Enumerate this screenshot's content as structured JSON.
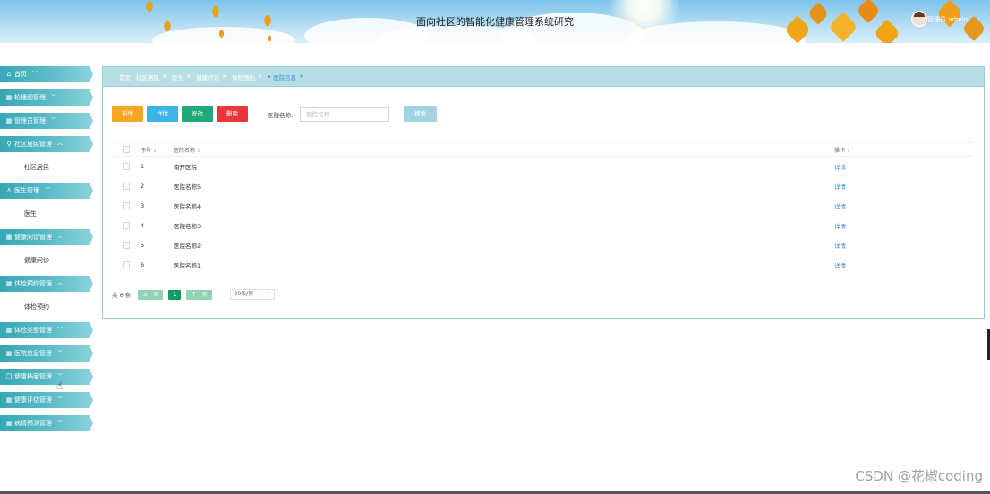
{
  "header": {
    "title": "面向社区的智能化健康管理系统研究",
    "user": "管理员 admin"
  },
  "sidebar": {
    "items": [
      {
        "label": "首页",
        "icon": "home-icon",
        "expanded": false
      },
      {
        "label": "轮播图管理",
        "icon": "grid-icon",
        "expanded": false
      },
      {
        "label": "管理员管理",
        "icon": "grid-icon",
        "expanded": false
      },
      {
        "label": "社区居民管理",
        "icon": "user-lock-icon",
        "expanded": true,
        "children": [
          "社区居民"
        ]
      },
      {
        "label": "医生管理",
        "icon": "user-icon",
        "expanded": true,
        "children": [
          "医生"
        ]
      },
      {
        "label": "健康问诊管理",
        "icon": "grid-icon",
        "expanded": true,
        "children": [
          "健康问诊"
        ]
      },
      {
        "label": "体检预约管理",
        "icon": "grid-icon",
        "expanded": true,
        "children": [
          "体检预约"
        ]
      },
      {
        "label": "体检类型管理",
        "icon": "grid-icon",
        "expanded": false
      },
      {
        "label": "医院信息管理",
        "icon": "grid-icon",
        "expanded": false
      },
      {
        "label": "健康档案管理",
        "icon": "copy-icon",
        "expanded": false
      },
      {
        "label": "健康评估管理",
        "icon": "grid-icon",
        "expanded": false
      },
      {
        "label": "病情预测管理",
        "icon": "grid-icon",
        "expanded": false
      }
    ]
  },
  "tabs": [
    {
      "label": "首页",
      "active": false
    },
    {
      "label": "社区居民",
      "active": false
    },
    {
      "label": "医生",
      "active": false
    },
    {
      "label": "健康问诊",
      "active": false
    },
    {
      "label": "体检预约",
      "active": false
    },
    {
      "label": "医院信息",
      "active": true
    }
  ],
  "toolbar": {
    "add": "新增",
    "detail": "详情",
    "edit": "修改",
    "delete": "删除",
    "search_label": "医院名称:",
    "search_placeholder": "医院名称",
    "search_button": "搜索"
  },
  "table": {
    "columns": [
      "序号",
      "医院名称",
      "操作"
    ],
    "rows": [
      {
        "no": "1",
        "name": "南开医院",
        "action": "详情"
      },
      {
        "no": "2",
        "name": "医院名称5",
        "action": "详情"
      },
      {
        "no": "3",
        "name": "医院名称4",
        "action": "详情"
      },
      {
        "no": "4",
        "name": "医院名称3",
        "action": "详情"
      },
      {
        "no": "5",
        "name": "医院名称2",
        "action": "详情"
      },
      {
        "no": "6",
        "name": "医院名称1",
        "action": "详情"
      }
    ]
  },
  "pager": {
    "total": "共 6 条",
    "prev": "上一页",
    "current": "1",
    "next": "下一页",
    "page_size": "20条/页"
  },
  "watermark": "CSDN @花椒coding",
  "colors": {
    "sidebar": "#4bb4c1",
    "tabbar": "#b9dfe6",
    "add": "#f5a623",
    "detail": "#3cb4e8",
    "edit": "#1faa78",
    "delete": "#e9363b",
    "link": "#3a8fd6"
  }
}
